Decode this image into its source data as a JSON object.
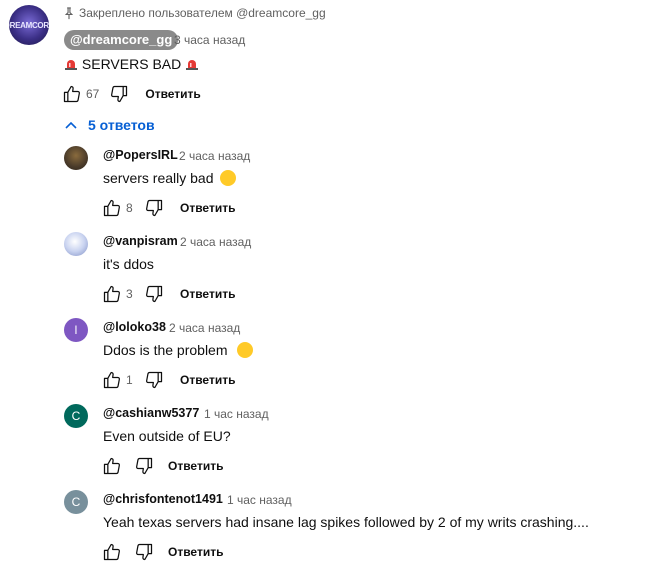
{
  "pinned": {
    "text": "Закреплено пользователем @dreamcore_gg"
  },
  "top_comment": {
    "author": "@dreamcore_gg",
    "time": "3 часа назад",
    "text": "SERVERS BAD",
    "likes": "67",
    "reply_label": "Ответить"
  },
  "replies_toggle": {
    "label": "5 ответов"
  },
  "replies": [
    {
      "author": "@PopersIRL",
      "time": "2 часа назад",
      "text": "servers really bad",
      "likes": "8",
      "reply_label": "Ответить",
      "avatar_color": "#4a3b2a"
    },
    {
      "author": "@vanpisram",
      "time": "2 часа назад",
      "text": "it's ddos",
      "likes": "3",
      "reply_label": "Ответить",
      "avatar_color": "#c9d3f0"
    },
    {
      "author": "@loloko38",
      "time": "2 часа назад",
      "text": "Ddos is the problem",
      "likes": "1",
      "reply_label": "Ответить",
      "avatar_letter": "l",
      "avatar_color": "#7e57c2"
    },
    {
      "author": "@cashianw5377",
      "time": "1 час назад",
      "text": "Even outside of EU?",
      "likes": "",
      "reply_label": "Ответить",
      "avatar_letter": "C",
      "avatar_color": "#00695c"
    },
    {
      "author": "@chrisfontenot1491",
      "time": "1 час назад",
      "text": "Yeah texas servers had insane lag spikes followed by 2 of my writs crashing....",
      "likes": "",
      "reply_label": "Ответить",
      "avatar_letter": "C",
      "avatar_color": "#78909c"
    }
  ]
}
